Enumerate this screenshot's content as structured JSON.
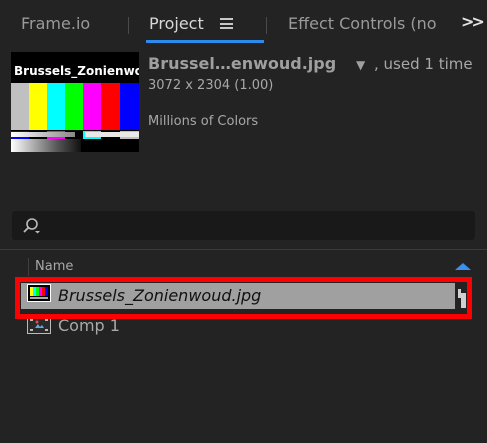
{
  "tabs": {
    "frameio": "Frame.io",
    "project": "Project",
    "effect_controls": "Effect Controls (no"
  },
  "colors": {
    "accent": "#2d8ceb",
    "highlight": "#ff0000",
    "selection": "#a0a0a0"
  },
  "preview": {
    "thumbnail_title": "Brussels_Zonienwo",
    "name": "Brussel…enwoud.jpg",
    "usage": ", used 1 time",
    "dimensions": "3072 x 2304 (1.00)",
    "color_depth": "Millions of Colors"
  },
  "search": {
    "value": ""
  },
  "list": {
    "column_header": "Name",
    "items": [
      {
        "name": "Brussels_Zonienwoud.jpg",
        "icon": "image-footage-icon",
        "selected": true
      },
      {
        "name": "Comp 1",
        "icon": "composition-icon",
        "selected": false
      }
    ]
  }
}
